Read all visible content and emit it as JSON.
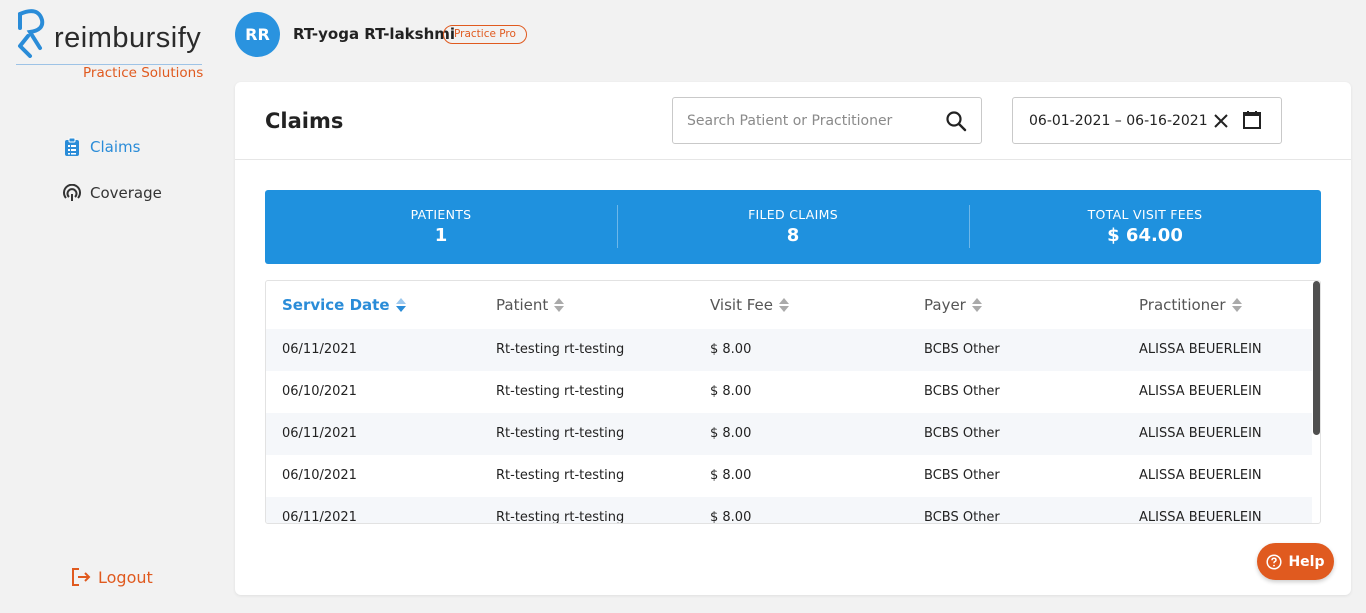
{
  "brand": {
    "name": "reimbursify",
    "tagline": "Practice Solutions",
    "accent": "#e05a1f",
    "primary": "#1f91de"
  },
  "user": {
    "initials": "RR",
    "name": "RT-yoga RT-lakshmi",
    "plan": "Practice Pro"
  },
  "sidebar": {
    "items": [
      {
        "label": "Claims",
        "icon": "clipboard-icon",
        "active": true
      },
      {
        "label": "Coverage",
        "icon": "coverage-icon",
        "active": false
      }
    ],
    "logout_label": "Logout"
  },
  "main": {
    "title": "Claims",
    "search": {
      "placeholder": "Search Patient or Practitioner",
      "value": ""
    },
    "date_range": "06-01-2021 – 06-16-2021"
  },
  "stats": [
    {
      "label": "PATIENTS",
      "value": "1"
    },
    {
      "label": "FILED CLAIMS",
      "value": "8"
    },
    {
      "label": "TOTAL VISIT FEES",
      "value": "$ 64.00"
    }
  ],
  "table": {
    "columns": [
      "Service Date",
      "Patient",
      "Visit Fee",
      "Payer",
      "Practitioner"
    ],
    "sorted_column": "Service Date",
    "rows": [
      [
        "06/11/2021",
        "Rt-testing rt-testing",
        "$ 8.00",
        "BCBS Other",
        "ALISSA BEUERLEIN"
      ],
      [
        "06/10/2021",
        "Rt-testing rt-testing",
        "$ 8.00",
        "BCBS Other",
        "ALISSA BEUERLEIN"
      ],
      [
        "06/11/2021",
        "Rt-testing rt-testing",
        "$ 8.00",
        "BCBS Other",
        "ALISSA BEUERLEIN"
      ],
      [
        "06/10/2021",
        "Rt-testing rt-testing",
        "$ 8.00",
        "BCBS Other",
        "ALISSA BEUERLEIN"
      ],
      [
        "06/11/2021",
        "Rt-testing rt-testing",
        "$ 8.00",
        "BCBS Other",
        "ALISSA BEUERLEIN"
      ]
    ]
  },
  "help": {
    "label": "Help"
  }
}
